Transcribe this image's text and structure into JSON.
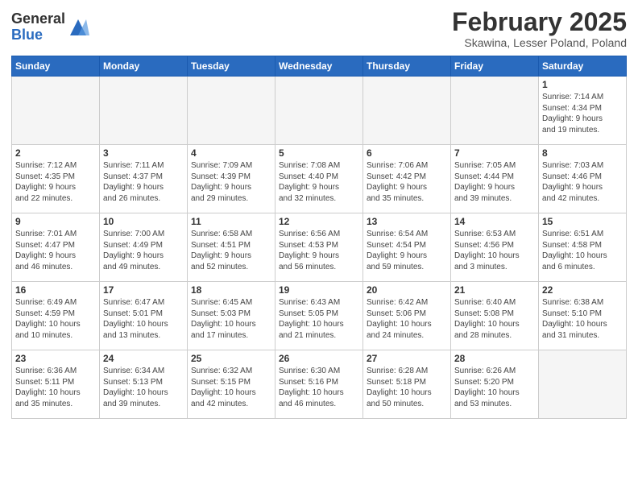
{
  "header": {
    "logo": {
      "line1": "General",
      "line2": "Blue"
    },
    "title": "February 2025",
    "location": "Skawina, Lesser Poland, Poland"
  },
  "weekdays": [
    "Sunday",
    "Monday",
    "Tuesday",
    "Wednesday",
    "Thursday",
    "Friday",
    "Saturday"
  ],
  "weeks": [
    [
      {
        "day": "",
        "info": ""
      },
      {
        "day": "",
        "info": ""
      },
      {
        "day": "",
        "info": ""
      },
      {
        "day": "",
        "info": ""
      },
      {
        "day": "",
        "info": ""
      },
      {
        "day": "",
        "info": ""
      },
      {
        "day": "1",
        "info": "Sunrise: 7:14 AM\nSunset: 4:34 PM\nDaylight: 9 hours\nand 19 minutes."
      }
    ],
    [
      {
        "day": "2",
        "info": "Sunrise: 7:12 AM\nSunset: 4:35 PM\nDaylight: 9 hours\nand 22 minutes."
      },
      {
        "day": "3",
        "info": "Sunrise: 7:11 AM\nSunset: 4:37 PM\nDaylight: 9 hours\nand 26 minutes."
      },
      {
        "day": "4",
        "info": "Sunrise: 7:09 AM\nSunset: 4:39 PM\nDaylight: 9 hours\nand 29 minutes."
      },
      {
        "day": "5",
        "info": "Sunrise: 7:08 AM\nSunset: 4:40 PM\nDaylight: 9 hours\nand 32 minutes."
      },
      {
        "day": "6",
        "info": "Sunrise: 7:06 AM\nSunset: 4:42 PM\nDaylight: 9 hours\nand 35 minutes."
      },
      {
        "day": "7",
        "info": "Sunrise: 7:05 AM\nSunset: 4:44 PM\nDaylight: 9 hours\nand 39 minutes."
      },
      {
        "day": "8",
        "info": "Sunrise: 7:03 AM\nSunset: 4:46 PM\nDaylight: 9 hours\nand 42 minutes."
      }
    ],
    [
      {
        "day": "9",
        "info": "Sunrise: 7:01 AM\nSunset: 4:47 PM\nDaylight: 9 hours\nand 46 minutes."
      },
      {
        "day": "10",
        "info": "Sunrise: 7:00 AM\nSunset: 4:49 PM\nDaylight: 9 hours\nand 49 minutes."
      },
      {
        "day": "11",
        "info": "Sunrise: 6:58 AM\nSunset: 4:51 PM\nDaylight: 9 hours\nand 52 minutes."
      },
      {
        "day": "12",
        "info": "Sunrise: 6:56 AM\nSunset: 4:53 PM\nDaylight: 9 hours\nand 56 minutes."
      },
      {
        "day": "13",
        "info": "Sunrise: 6:54 AM\nSunset: 4:54 PM\nDaylight: 9 hours\nand 59 minutes."
      },
      {
        "day": "14",
        "info": "Sunrise: 6:53 AM\nSunset: 4:56 PM\nDaylight: 10 hours\nand 3 minutes."
      },
      {
        "day": "15",
        "info": "Sunrise: 6:51 AM\nSunset: 4:58 PM\nDaylight: 10 hours\nand 6 minutes."
      }
    ],
    [
      {
        "day": "16",
        "info": "Sunrise: 6:49 AM\nSunset: 4:59 PM\nDaylight: 10 hours\nand 10 minutes."
      },
      {
        "day": "17",
        "info": "Sunrise: 6:47 AM\nSunset: 5:01 PM\nDaylight: 10 hours\nand 13 minutes."
      },
      {
        "day": "18",
        "info": "Sunrise: 6:45 AM\nSunset: 5:03 PM\nDaylight: 10 hours\nand 17 minutes."
      },
      {
        "day": "19",
        "info": "Sunrise: 6:43 AM\nSunset: 5:05 PM\nDaylight: 10 hours\nand 21 minutes."
      },
      {
        "day": "20",
        "info": "Sunrise: 6:42 AM\nSunset: 5:06 PM\nDaylight: 10 hours\nand 24 minutes."
      },
      {
        "day": "21",
        "info": "Sunrise: 6:40 AM\nSunset: 5:08 PM\nDaylight: 10 hours\nand 28 minutes."
      },
      {
        "day": "22",
        "info": "Sunrise: 6:38 AM\nSunset: 5:10 PM\nDaylight: 10 hours\nand 31 minutes."
      }
    ],
    [
      {
        "day": "23",
        "info": "Sunrise: 6:36 AM\nSunset: 5:11 PM\nDaylight: 10 hours\nand 35 minutes."
      },
      {
        "day": "24",
        "info": "Sunrise: 6:34 AM\nSunset: 5:13 PM\nDaylight: 10 hours\nand 39 minutes."
      },
      {
        "day": "25",
        "info": "Sunrise: 6:32 AM\nSunset: 5:15 PM\nDaylight: 10 hours\nand 42 minutes."
      },
      {
        "day": "26",
        "info": "Sunrise: 6:30 AM\nSunset: 5:16 PM\nDaylight: 10 hours\nand 46 minutes."
      },
      {
        "day": "27",
        "info": "Sunrise: 6:28 AM\nSunset: 5:18 PM\nDaylight: 10 hours\nand 50 minutes."
      },
      {
        "day": "28",
        "info": "Sunrise: 6:26 AM\nSunset: 5:20 PM\nDaylight: 10 hours\nand 53 minutes."
      },
      {
        "day": "",
        "info": ""
      }
    ]
  ]
}
